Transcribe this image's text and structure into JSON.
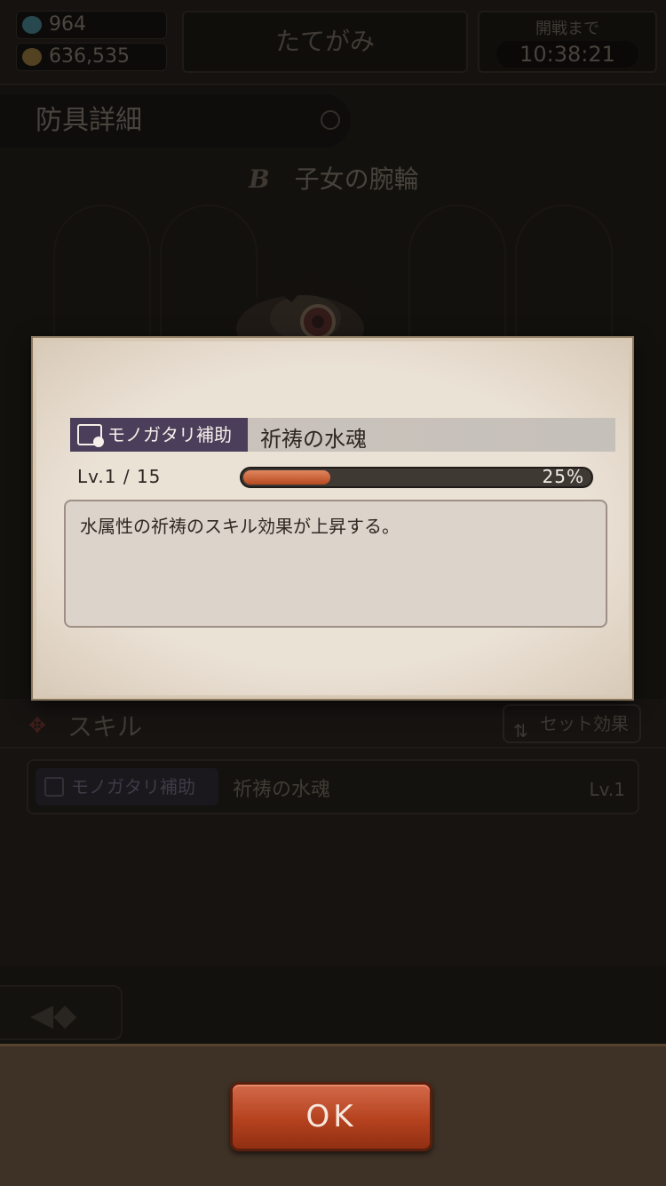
{
  "status": {
    "gems": "964",
    "gold": "636,535",
    "player_name": "たてがみ",
    "timer_caption": "開戦まで",
    "timer_value": "10:38:21"
  },
  "header": {
    "title": "防具詳細"
  },
  "item": {
    "rank": "B",
    "name": "子女の腕輪"
  },
  "skills_section": {
    "label": "スキル",
    "set_effect_label": "セット効果",
    "rows": [
      {
        "tag": "モノガタリ補助",
        "name": "祈祷の水魂",
        "level": "Lv.1"
      }
    ]
  },
  "modal": {
    "badge": "モノガタリ補助",
    "skill_name": "祈祷の水魂",
    "level_text": "Lv.1 / 15",
    "progress_percent": 25,
    "progress_label": "25%",
    "description": "水属性の祈祷のスキル効果が上昇する。"
  },
  "ok_label": "OK",
  "colors": {
    "accent": "#b5421f",
    "badge": "#4a3e5a",
    "panel": "#ebe2d6"
  }
}
